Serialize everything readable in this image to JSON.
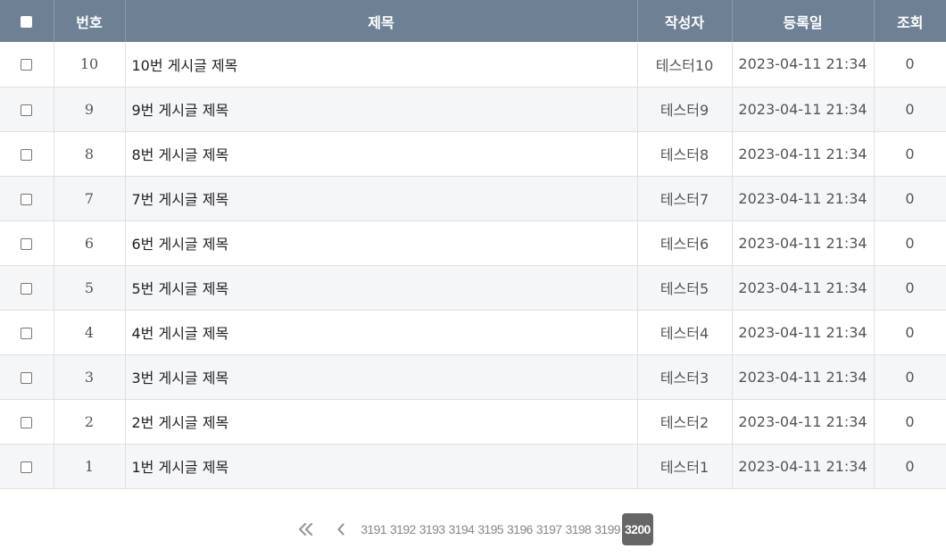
{
  "table": {
    "headers": [
      "번호",
      "제목",
      "작성자",
      "등록일",
      "조회"
    ],
    "rows": [
      {
        "no": "10",
        "title": "10번 게시글 제목",
        "author": "테스터10",
        "date": "2023-04-11 21:34",
        "views": "0"
      },
      {
        "no": "9",
        "title": "9번 게시글 제목",
        "author": "테스터9",
        "date": "2023-04-11 21:34",
        "views": "0"
      },
      {
        "no": "8",
        "title": "8번 게시글 제목",
        "author": "테스터8",
        "date": "2023-04-11 21:34",
        "views": "0"
      },
      {
        "no": "7",
        "title": "7번 게시글 제목",
        "author": "테스터7",
        "date": "2023-04-11 21:34",
        "views": "0"
      },
      {
        "no": "6",
        "title": "6번 게시글 제목",
        "author": "테스터6",
        "date": "2023-04-11 21:34",
        "views": "0"
      },
      {
        "no": "5",
        "title": "5번 게시글 제목",
        "author": "테스터5",
        "date": "2023-04-11 21:34",
        "views": "0"
      },
      {
        "no": "4",
        "title": "4번 게시글 제목",
        "author": "테스터4",
        "date": "2023-04-11 21:34",
        "views": "0"
      },
      {
        "no": "3",
        "title": "3번 게시글 제목",
        "author": "테스터3",
        "date": "2023-04-11 21:34",
        "views": "0"
      },
      {
        "no": "2",
        "title": "2번 게시글 제목",
        "author": "테스터2",
        "date": "2023-04-11 21:34",
        "views": "0"
      },
      {
        "no": "1",
        "title": "1번 게시글 제목",
        "author": "테스터1",
        "date": "2023-04-11 21:34",
        "views": "0"
      }
    ]
  },
  "pagination": {
    "first_icon": "double-chevron-left-icon",
    "prev_icon": "chevron-left-icon",
    "pages": [
      "3191",
      "3192",
      "3193",
      "3194",
      "3195",
      "3196",
      "3197",
      "3198",
      "3199",
      "3200"
    ],
    "current": "3200"
  },
  "colors": {
    "header_bg": "#6e8194",
    "row_alt_bg": "#f5f6f8",
    "active_page_bg": "#666666"
  }
}
